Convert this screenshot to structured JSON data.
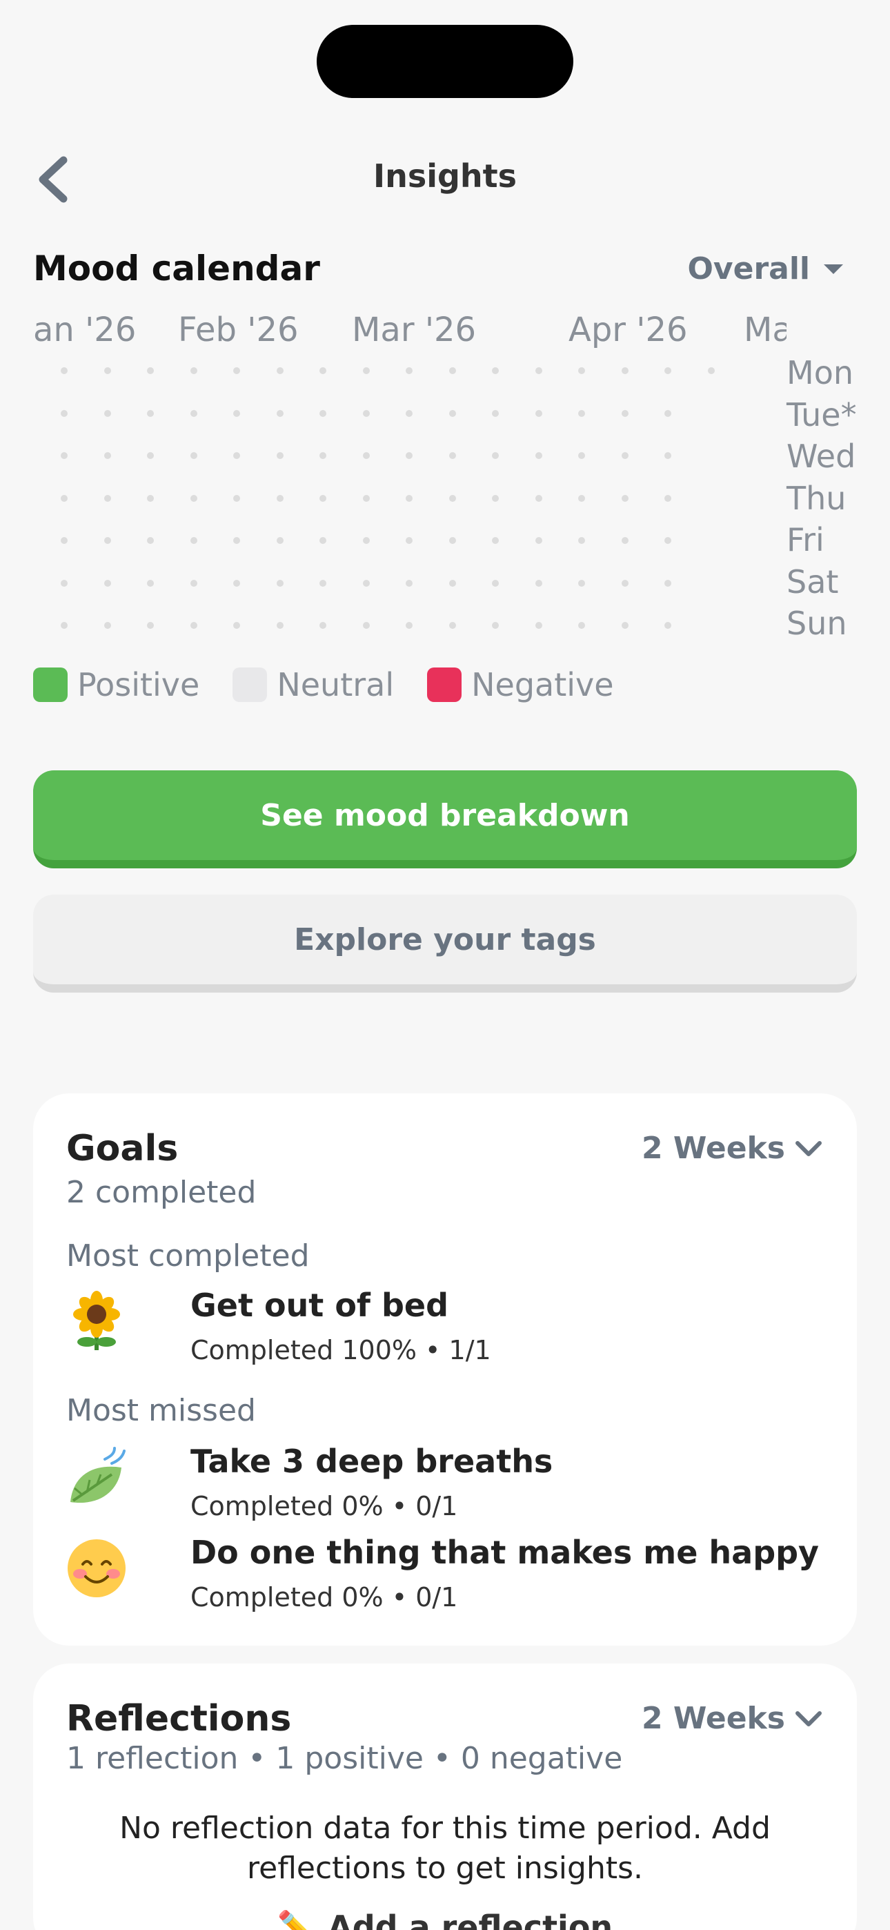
{
  "header": {
    "title": "Insights"
  },
  "mood_calendar": {
    "title": "Mood calendar",
    "filter": "Overall",
    "months": [
      "an '26",
      "Feb '26",
      "Mar '26",
      "Apr '26",
      "Ma"
    ],
    "days": [
      "Mon",
      "Tue*",
      "Wed",
      "Thu",
      "Fri",
      "Sat",
      "Sun"
    ],
    "legend": [
      {
        "label": "Positive",
        "color": "#5bbb55"
      },
      {
        "label": "Neutral",
        "color": "#e8e8ea"
      },
      {
        "label": "Negative",
        "color": "#e8315a"
      }
    ]
  },
  "buttons": {
    "mood_breakdown": "See mood breakdown",
    "explore_tags": "Explore your tags"
  },
  "goals": {
    "title": "Goals",
    "subtitle": "2 completed",
    "period": "2 Weeks",
    "most_completed_label": "Most completed",
    "most_missed_label": "Most missed",
    "items": [
      {
        "name": "Get out of bed",
        "meta": "Completed 100% • 1/1",
        "icon": "sunflower-icon"
      },
      {
        "name": "Take 3 deep breaths",
        "meta": "Completed 0% • 0/1",
        "icon": "leaf-wind-icon"
      },
      {
        "name": "Do one thing that makes me happy",
        "meta": "Completed 0% • 0/1",
        "icon": "smiling-face-icon"
      }
    ]
  },
  "reflections": {
    "title": "Reflections",
    "subtitle": "1 reflection • 1 positive • 0 negative",
    "period": "2 Weeks",
    "empty_text": "No reflection data for this time period. Add reflections to get insights.",
    "add_label": "Add a reflection"
  }
}
